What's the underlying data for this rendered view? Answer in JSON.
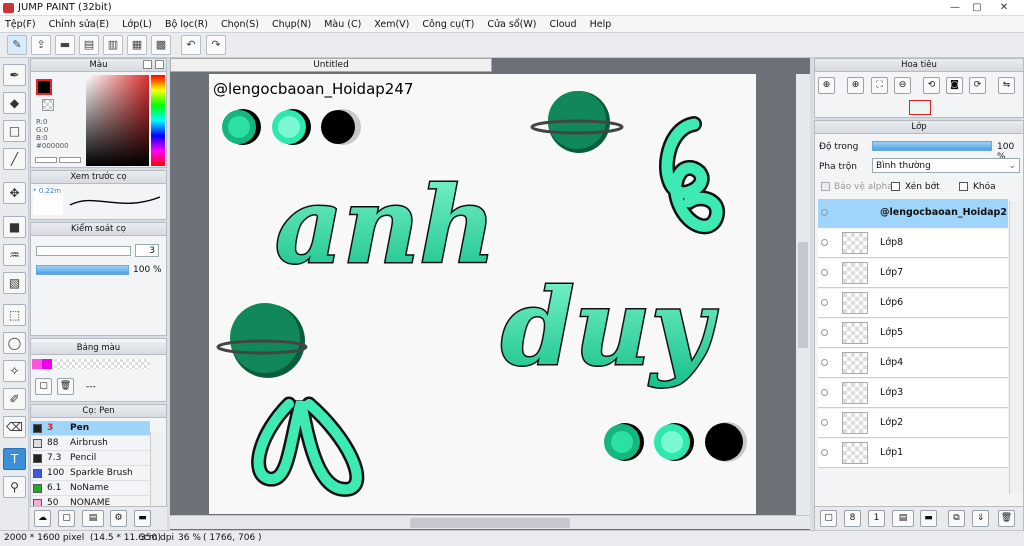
{
  "window": {
    "title": "JUMP PAINT (32bit)",
    "minimize": "—",
    "restore": "▢",
    "close": "✕"
  },
  "menu": [
    "Tệp(F)",
    "Chỉnh sửa(E)",
    "Lớp(L)",
    "Bộ lọc(R)",
    "Chọn(S)",
    "Chụp(N)",
    "Màu (C)",
    "Xem(V)",
    "Công cụ(T)",
    "Cửa sổ(W)",
    "Cloud",
    "Help"
  ],
  "color_panel": {
    "title": "Màu",
    "r": "R:0",
    "g": "G:0",
    "b": "B:0",
    "hex": "#000000",
    "primary": "#000000",
    "secondary": "#ffffff"
  },
  "preview_panel": {
    "title": "Xem trước cọ",
    "size": "* 0.22m"
  },
  "brush_control": {
    "title": "Kiểm soát cọ",
    "size_value": "3",
    "opacity_value": "100 %"
  },
  "palette": {
    "title": "Bảng màu",
    "label": "---",
    "colors": [
      "#ff55dd",
      "#ee00ee"
    ]
  },
  "brushes": {
    "title": "Cọ: Pen",
    "items": [
      {
        "size": "3",
        "name": "Pen",
        "color": "#222222",
        "selected": true
      },
      {
        "size": "88",
        "name": "Airbrush",
        "color": "#dddddd",
        "selected": false
      },
      {
        "size": "7.3",
        "name": "Pencil",
        "color": "#222222",
        "selected": false
      },
      {
        "size": "100",
        "name": "Sparkle Brush",
        "color": "#4455dd",
        "selected": false
      },
      {
        "size": "6.1",
        "name": "NoName",
        "color": "#22aa22",
        "selected": false
      },
      {
        "size": "50",
        "name": "NONAME",
        "color": "#ffaadd",
        "selected": false
      }
    ]
  },
  "canvas": {
    "tab": "Untitled",
    "watermark": "@lengocbaoan_Hoidap247",
    "word1": "anh",
    "word2": "duy",
    "stroke_color": "#111111",
    "fill_color": "#2ee0a8",
    "planet_color": "#11885a"
  },
  "navigator": {
    "title": "Hoa tiêu"
  },
  "layers_panel": {
    "title": "Lớp",
    "opacity_label": "Độ trong",
    "opacity_value": "100 %",
    "opacity_fraction": 1.0,
    "blend_label": "Pha trộn",
    "blend_value": "Bình thường",
    "alpha_label": "Bảo vệ alpha",
    "clip_label": "Xén bớt",
    "lock_label": "Khóa",
    "layers": [
      "@lengocbaoan_Hoidap2",
      "Lớp8",
      "Lớp7",
      "Lớp6",
      "Lớp5",
      "Lớp4",
      "Lớp3",
      "Lớp2",
      "Lớp1"
    ]
  },
  "status": {
    "dims": "2000 * 1600 pixel",
    "cm": "(14.5 * 11.6cm)",
    "dpi": "350 dpi",
    "zoom": "36 %",
    "coords": "( 1766, 706 )"
  }
}
